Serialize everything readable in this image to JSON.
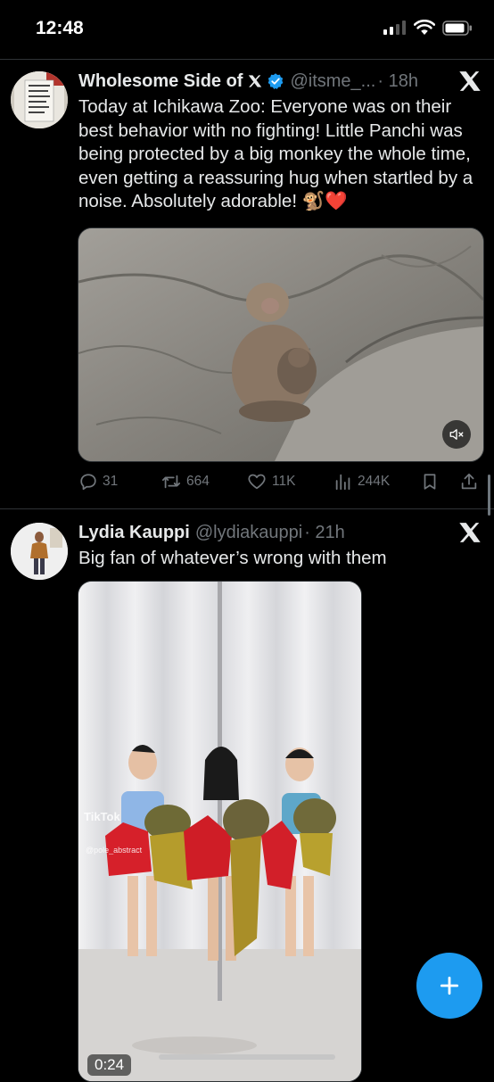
{
  "status_bar": {
    "time": "12:48"
  },
  "tweets": [
    {
      "author": {
        "display_name": "Wholesome Side of",
        "handle": "@itsme_...",
        "time": "· 18h"
      },
      "text": "Today at Ichikawa Zoo: Everyone was on their best behavior with no fighting! Little Panchi was being protected by a big monkey the whole time, even getting a reassuring hug when startled by a noise. Absolutely adorable! 🐒❤️",
      "actions": {
        "replies": "31",
        "reposts": "664",
        "likes": "11K",
        "views": "244K"
      }
    },
    {
      "author": {
        "display_name": "Lydia Kauppi",
        "handle": "@lydiakauppi",
        "time": "· 21h"
      },
      "text": "Big fan of whatever’s wrong with them",
      "media": {
        "duration": "0:24",
        "tiktok_label": "TikTok",
        "tiktok_user": "@pole_abstract"
      }
    }
  ],
  "icons": {
    "verified": "verified-badge-icon",
    "x_logo": "x-logo-icon",
    "close": "x-close-icon",
    "reply": "reply-icon",
    "repost": "repost-icon",
    "like": "heart-icon",
    "views": "views-chart-icon",
    "bookmark": "bookmark-icon",
    "share": "share-icon",
    "compose": "plus-icon",
    "mute": "mute-icon"
  },
  "colors": {
    "background": "#000000",
    "accent": "#1d9bf0",
    "text": "#e7e9ea",
    "muted": "#71767b"
  }
}
